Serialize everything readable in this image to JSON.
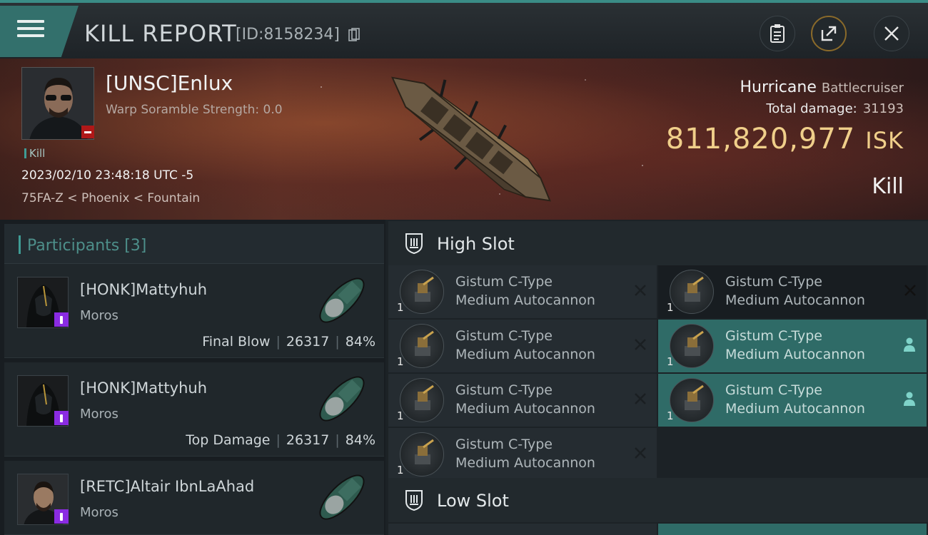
{
  "header": {
    "title": "KILL REPORT",
    "report_id": "[ID:8158234]"
  },
  "victim": {
    "name": "[UNSC]Enlux",
    "warp_scramble": "Warp Soramble Strength: 0.0",
    "kill_tag": "Kill",
    "datetime": "2023/02/10 23:48:18 UTC -5",
    "location": "75FA-Z < Phoenix < Fountain",
    "ship_type": "Hurricane",
    "ship_class": "Battlecruiser",
    "total_damage_label": "Total damage:",
    "total_damage": "31193",
    "isk_value": "811,820,977",
    "isk_unit": "ISK",
    "result": "Kill"
  },
  "participants": {
    "title": "Participants [3]",
    "items": [
      {
        "name": "[HONK]Mattyhuh",
        "ship": "Moros",
        "role": "Final Blow",
        "damage": "26317",
        "percent": "84%"
      },
      {
        "name": "[HONK]Mattyhuh",
        "ship": "Moros",
        "role": "Top Damage",
        "damage": "26317",
        "percent": "84%"
      },
      {
        "name": "[RETC]Altair IbnLaAhad",
        "ship": "Moros",
        "role": "",
        "damage": "",
        "percent": ""
      }
    ]
  },
  "slots": {
    "high_title": "High Slot",
    "low_title": "Low Slot",
    "high_modules": [
      {
        "qty": "1",
        "line1": "Gistum C-Type",
        "line2": "Medium Autocannon",
        "state": "destroyed"
      },
      {
        "qty": "1",
        "line1": "Gistum C-Type",
        "line2": "Medium Autocannon",
        "state": "destroyed"
      },
      {
        "qty": "1",
        "line1": "Gistum C-Type",
        "line2": "Medium Autocannon",
        "state": "destroyed"
      },
      {
        "qty": "1",
        "line1": "Gistum C-Type",
        "line2": "Medium Autocannon",
        "state": "dropped"
      },
      {
        "qty": "1",
        "line1": "Gistum C-Type",
        "line2": "Medium Autocannon",
        "state": "destroyed"
      },
      {
        "qty": "1",
        "line1": "Gistum C-Type",
        "line2": "Medium Autocannon",
        "state": "dropped"
      },
      {
        "qty": "1",
        "line1": "Gistum C-Type",
        "line2": "Medium Autocannon",
        "state": "destroyed"
      }
    ]
  },
  "colors": {
    "accent_teal": "#3a8c86",
    "isk_gold": "#f0cf8a",
    "badge_red": "#b01818",
    "badge_purple": "#8a2be2"
  }
}
